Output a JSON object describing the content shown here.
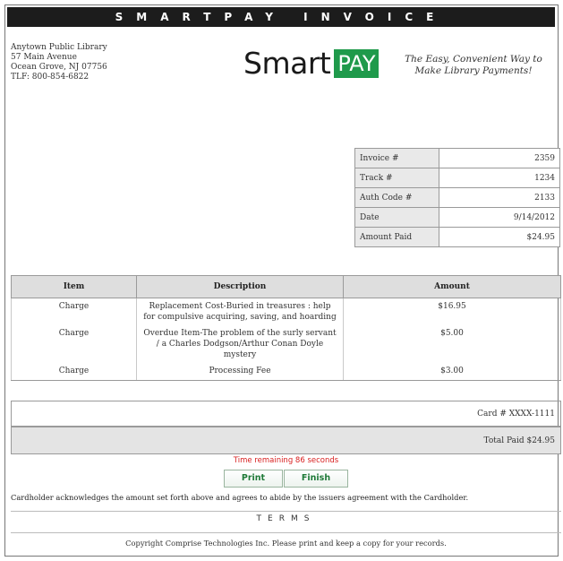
{
  "banner": {
    "title": "SMARTPAY INVOICE"
  },
  "library": {
    "name": "Anytown Public Library",
    "street": "57 Main Avenue",
    "city": "Ocean Grove, NJ 07756",
    "phone": "TLF: 800-854-6822"
  },
  "logo": {
    "smart": "Smart",
    "pay": "PAY",
    "color": "#1f9a4b"
  },
  "tagline": {
    "line1": "The Easy, Convenient Way to",
    "line2": "Make Library Payments!"
  },
  "summary": [
    {
      "label": "Invoice #",
      "value": "2359"
    },
    {
      "label": "Track #",
      "value": "1234"
    },
    {
      "label": "Auth Code #",
      "value": "2133"
    },
    {
      "label": "Date",
      "value": "9/14/2012"
    },
    {
      "label": "Amount Paid",
      "value": "$24.95"
    }
  ],
  "items_table": {
    "headers": [
      "Item",
      "Description",
      "Amount"
    ],
    "rows": [
      {
        "item": "Charge",
        "description": "Replacement Cost-Buried in treasures : help for compulsive acquiring, saving, and hoarding",
        "amount": "$16.95"
      },
      {
        "item": "Charge",
        "description": "Overdue Item-The problem of the surly servant / a Charles Dodgson/Arthur Conan Doyle mystery",
        "amount": "$5.00"
      },
      {
        "item": "Charge",
        "description": "Processing Fee",
        "amount": "$3.00"
      }
    ]
  },
  "card": "Card # XXXX-1111",
  "total": "Total Paid $24.95",
  "timer": "Time remaining 86 seconds",
  "buttons": {
    "print": "Print",
    "finish": "Finish"
  },
  "acknowledgement": "Cardholder acknowledges the amount set forth above and agrees to abide by the issuers agreement with the Cardholder.",
  "terms": "TERMS",
  "copyright": "Copyright Comprise Technologies Inc. Please print and keep a copy for your records.",
  "colors": {
    "timer": "#d81e1e",
    "button_text": "#1f7a38",
    "banner": "#1c1c1c"
  }
}
